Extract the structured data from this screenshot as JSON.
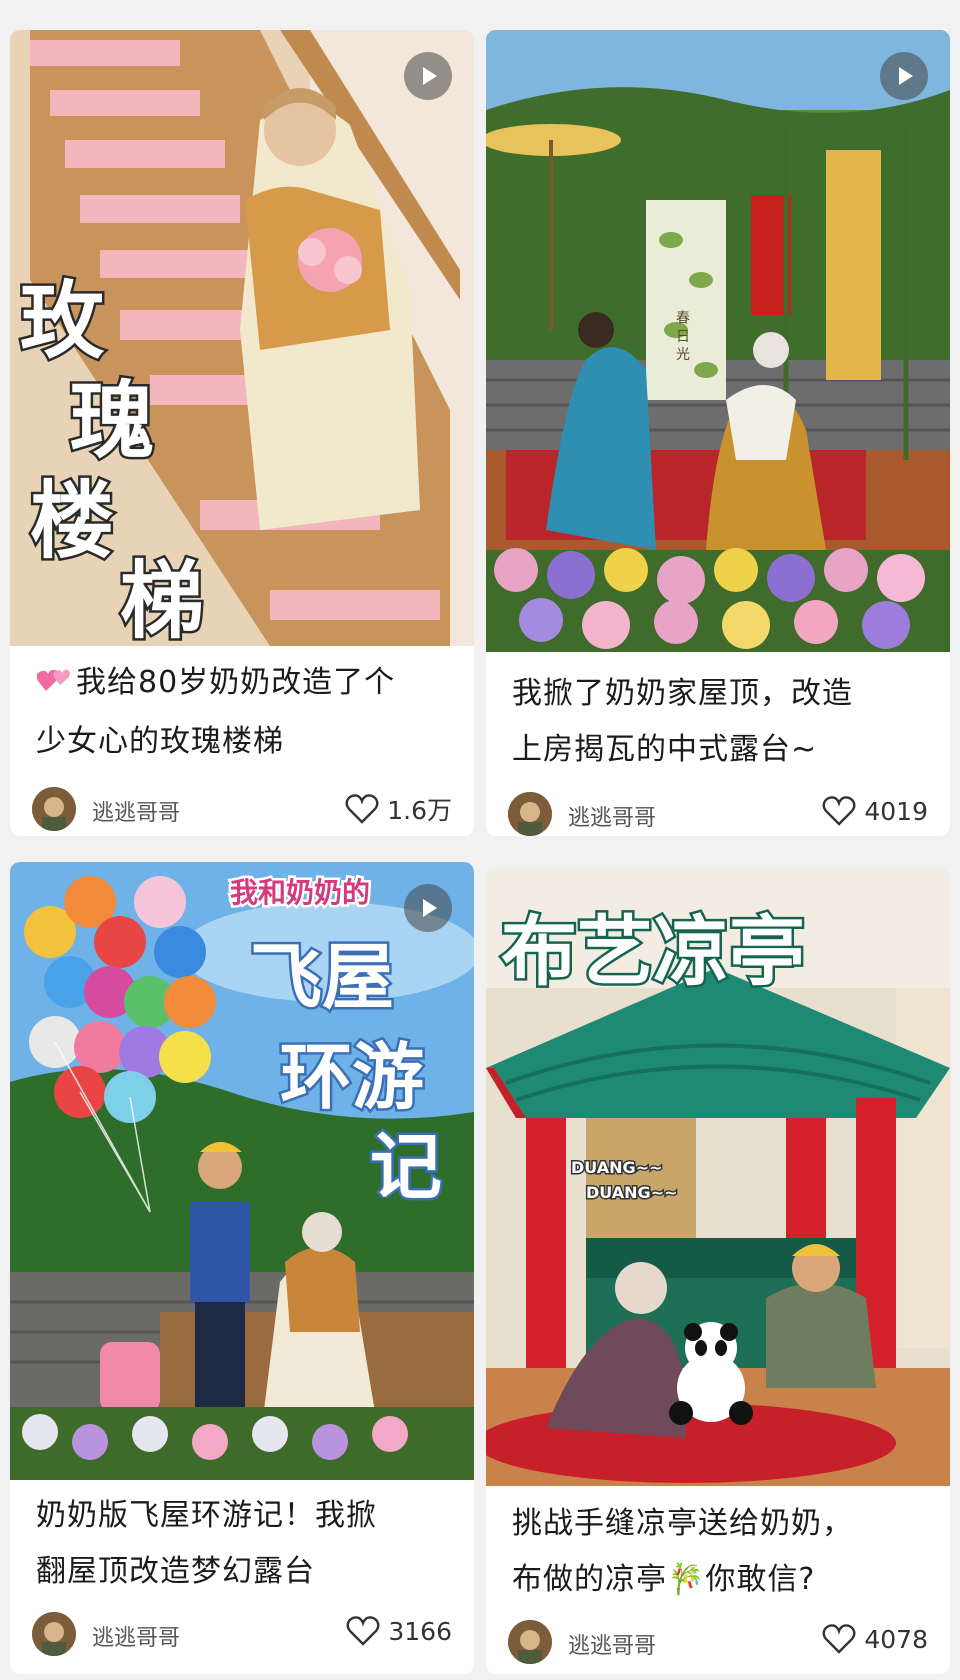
{
  "cards": [
    {
      "overlay_text": [
        "玫",
        "瑰",
        "楼",
        "梯"
      ],
      "title_line1": "我给80岁奶奶改造了个",
      "title_line2": "少女心的玫瑰楼梯",
      "author": "逃逃哥哥",
      "likes": "1.6万"
    },
    {
      "banner_text": "春 日 光",
      "title_line1": "我掀了奶奶家屋顶，改造",
      "title_line2": "上房揭瓦的中式露台~",
      "author": "逃逃哥哥",
      "likes": "4019"
    },
    {
      "overlay_small": "我和奶奶的",
      "overlay_text": [
        "飞屋",
        "环游",
        "记"
      ],
      "title_line1": "奶奶版飞屋环游记！我掀",
      "title_line2": "翻屋顶改造梦幻露台",
      "author": "逃逃哥哥",
      "likes": "3166"
    },
    {
      "overlay_text": "布艺凉亭",
      "sound_1": "DUANG~~",
      "sound_2": "DUANG~~",
      "title_line1": "挑战手缝凉亭送给奶奶，",
      "title_line2": "布做的凉亭🎋你敢信?",
      "author": "逃逃哥哥",
      "likes": "4078"
    }
  ],
  "icons": {
    "like": "heart-outline-icon",
    "play": "play-icon",
    "emoji": "two-hearts-icon"
  },
  "colors": {
    "background": "#f1f1f1",
    "card": "#ffffff",
    "text": "#1b1b1b",
    "meta": "#555555"
  }
}
